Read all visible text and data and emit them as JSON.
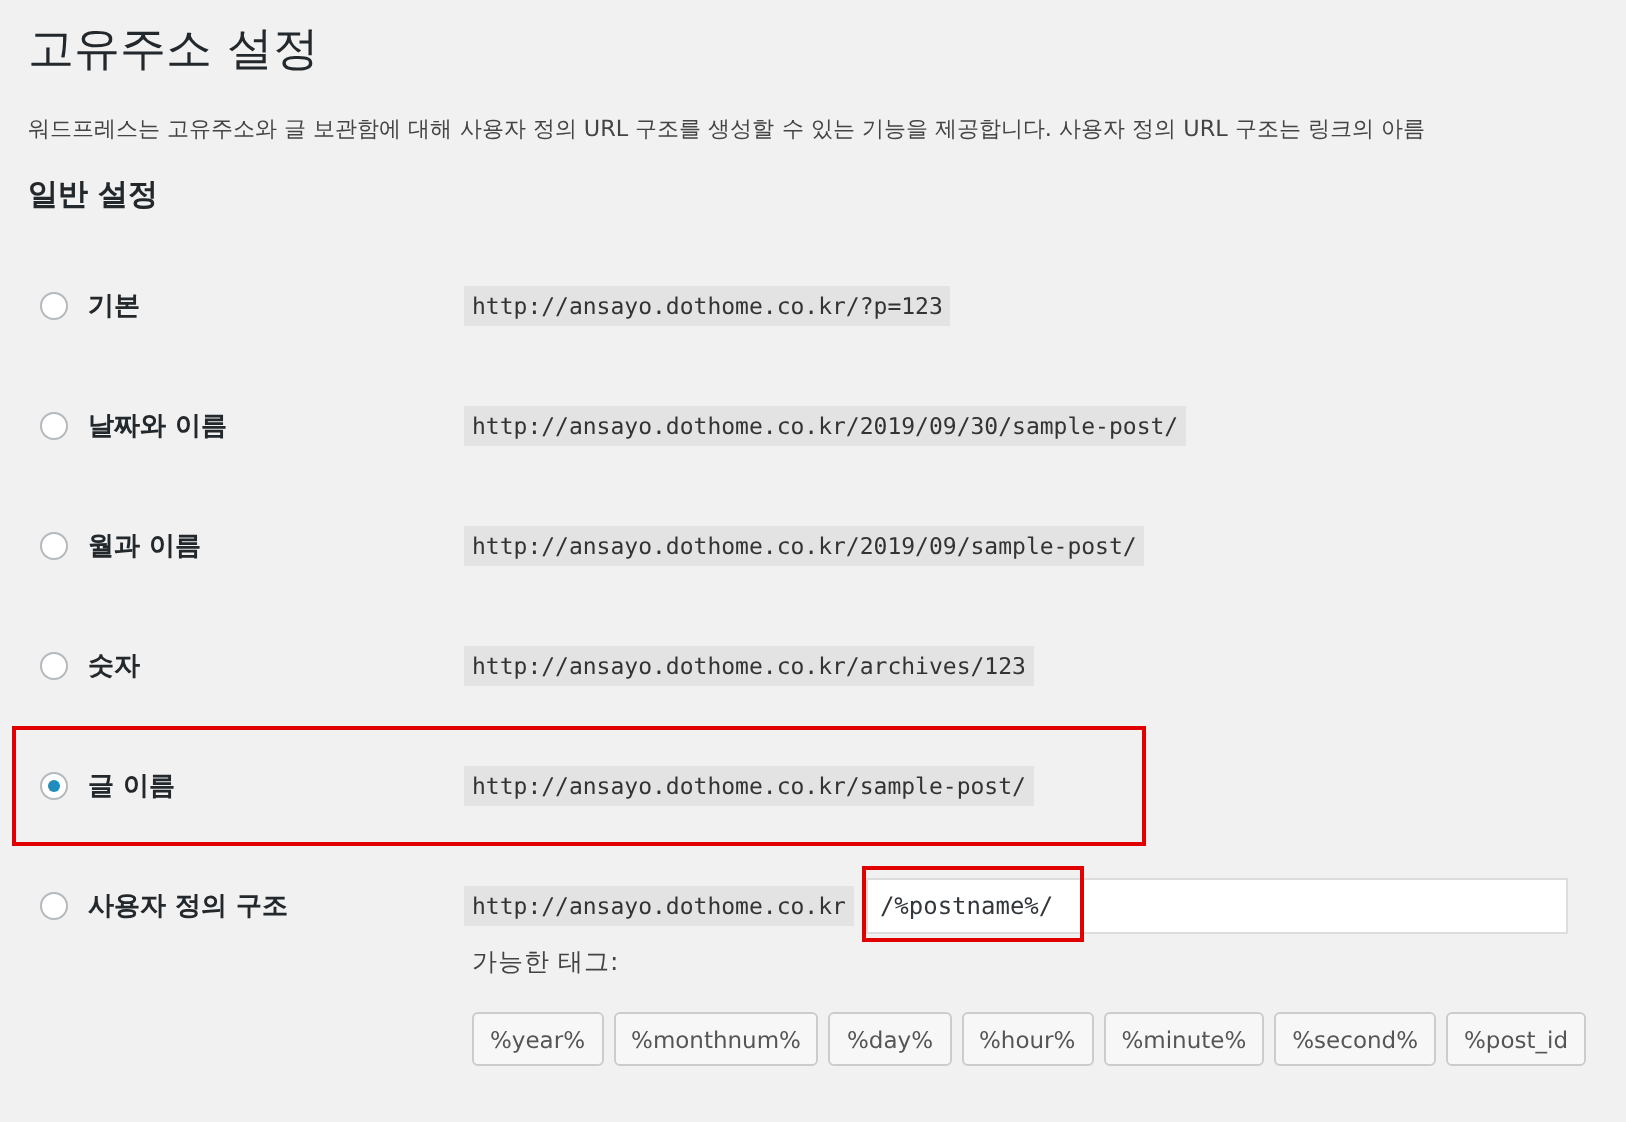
{
  "title": "고유주소 설정",
  "description": "워드프레스는 고유주소와 글 보관함에 대해 사용자 정의 URL 구조를 생성할 수 있는 기능을 제공합니다. 사용자 정의 URL 구조는 링크의 아름",
  "section_title": "일반 설정",
  "options": [
    {
      "label": "기본",
      "url": "http://ansayo.dothome.co.kr/?p=123",
      "selected": false,
      "highlighted": false
    },
    {
      "label": "날짜와 이름",
      "url": "http://ansayo.dothome.co.kr/2019/09/30/sample-post/",
      "selected": false,
      "highlighted": false
    },
    {
      "label": "월과 이름",
      "url": "http://ansayo.dothome.co.kr/2019/09/sample-post/",
      "selected": false,
      "highlighted": false
    },
    {
      "label": "숫자",
      "url": "http://ansayo.dothome.co.kr/archives/123",
      "selected": false,
      "highlighted": false
    },
    {
      "label": "글 이름",
      "url": "http://ansayo.dothome.co.kr/sample-post/",
      "selected": true,
      "highlighted": true
    }
  ],
  "custom": {
    "label": "사용자 정의 구조",
    "selected": false,
    "base_url": "http://ansayo.dothome.co.kr",
    "value": "/%postname%/",
    "highlighted": true,
    "tags_label": "가능한 태그:",
    "tags": [
      "%year%",
      "%monthnum%",
      "%day%",
      "%hour%",
      "%minute%",
      "%second%",
      "%post_id"
    ]
  }
}
